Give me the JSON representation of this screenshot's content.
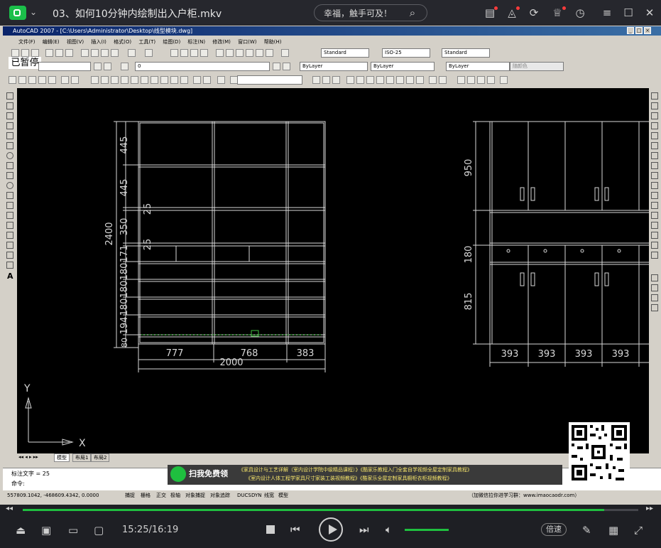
{
  "player": {
    "video_title": "03、如何10分钟内绘制出入户柜.mkv",
    "search_text": "幸福，触手可及！",
    "time_display": "15:25/16:19",
    "progress_fraction": 0.945,
    "volume_fraction": 1.0,
    "speed_label": "倍速",
    "accent_color": "#1fbf3f"
  },
  "acad": {
    "title": "AutoCAD 2007 - [C:\\Users\\Administrator\\Desktop\\线型模块.dwg]",
    "menu": [
      "文件(F)",
      "编辑(E)",
      "视图(V)",
      "插入(I)",
      "格式(O)",
      "工具(T)",
      "绘图(D)",
      "标注(N)",
      "修改(M)",
      "窗口(W)",
      "帮助(H)"
    ],
    "style_combo_1": "Standard",
    "style_combo_2": "ISO-25",
    "style_combo_3": "Standard",
    "layer_value": "0",
    "bylayer_color": "ByLayer",
    "bylayer_linetype": "ByLayer",
    "bylayer_lineweight": "ByLayer",
    "plot_style": "随颜色",
    "paused_badge": "已暂停",
    "tabs": [
      "模型",
      "布局1",
      "布局2"
    ],
    "command_line_1": "标注文字 = 25",
    "command_line_2": "命令:",
    "coordinates": "557809.1042, -468609.4342, 0.0000",
    "status_buttons": [
      "捕捉",
      "栅格",
      "正交",
      "极轴",
      "对象捕捉",
      "对象追踪",
      "DUCS",
      "DYN",
      "线宽",
      "模型"
    ],
    "ucs_x": "X",
    "ucs_y": "Y"
  },
  "drawing": {
    "left_vertical_dims": [
      "445",
      "445",
      "25",
      "350",
      "25",
      "171",
      "180",
      "180",
      "180",
      "194",
      "80"
    ],
    "left_total_height": "2400",
    "left_bottom_dims": [
      "777",
      "768",
      "383"
    ],
    "left_total_width": "2000",
    "right_vertical_dims": [
      "950",
      "180",
      "815"
    ],
    "right_bottom_dims": [
      "393",
      "393",
      "393",
      "393"
    ]
  },
  "promo": {
    "scan_label": "扫我免费领",
    "line_1": "《家具设计与工艺详解（室内设计学院中级精品课程）》《酷家乐教程入门全套自学视频全屋定制家具教程》",
    "line_2": "《室内设计人体工程学家具尺寸家装工装视频教程》《酷家乐全屋定制家具橱柜衣柜视频教程》",
    "site": "（加微信拉你进学习群：www.imaocaodr.com）"
  }
}
